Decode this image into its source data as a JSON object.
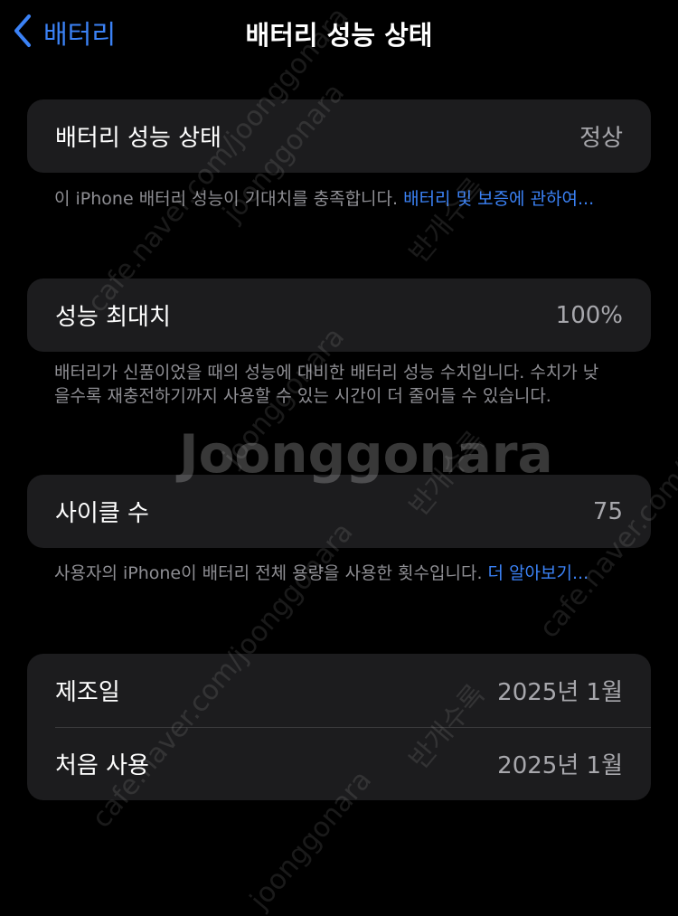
{
  "nav": {
    "back_label": "배터리",
    "title": "배터리 성능 상태"
  },
  "health_card": {
    "label": "배터리 성능 상태",
    "value": "정상"
  },
  "health_note": {
    "text": "이 iPhone 배터리 성능이 기대치를 충족합니다. ",
    "link": "배터리 및 보증에 관하여..."
  },
  "capacity_card": {
    "label": "성능 최대치",
    "value": "100%"
  },
  "capacity_note": {
    "text": "배터리가 신품이었을 때의 성능에 대비한 배터리 성능 수치입니다. 수치가 낮을수록 재충전하기까지 사용할 수 있는 시간이 더 줄어들 수 있습니다."
  },
  "cycle_card": {
    "label": "사이클 수",
    "value": "75"
  },
  "cycle_note": {
    "text": "사용자의 iPhone이 배터리 전체 용량을 사용한 횟수입니다. ",
    "link": "더 알아보기..."
  },
  "dates_card": {
    "manufactured_label": "제조일",
    "manufactured_value": "2025년 1월",
    "first_use_label": "처음 사용",
    "first_use_value": "2025년 1월"
  },
  "watermark": {
    "brand": "Joonggonara",
    "site": "cafe.naver.com/joonggonara",
    "tag": "반개수록",
    "short": "joonggonara"
  },
  "colors": {
    "accent": "#3b82f6",
    "background": "#000000",
    "card": "#1c1c1e",
    "secondary_text": "#a7a7ac"
  },
  "icons": {
    "back": "chevron-left-icon"
  }
}
